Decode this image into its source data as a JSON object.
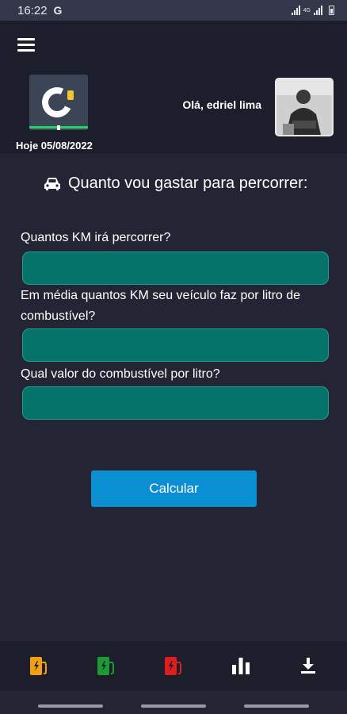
{
  "status_bar": {
    "time": "16:22",
    "g_label": "G",
    "lte": "4G"
  },
  "header": {
    "date_text": "Hoje 05/08/2022",
    "greeting": "Olá, edriel lima"
  },
  "form": {
    "title": "Quanto vou gastar para percorrer:",
    "km_label": "Quantos KM irá percorrer?",
    "km_value": "",
    "consumption_label": "Em média quantos KM seu veículo faz por litro de combustível?",
    "consumption_value": "",
    "price_label": "Qual valor do combustível por litro?",
    "price_value": "",
    "submit_label": "Calcular"
  },
  "bottom_nav": [
    {
      "icon": "fuel-pump-icon",
      "color": "#f0a010"
    },
    {
      "icon": "fuel-pump-icon",
      "color": "#1d9a33"
    },
    {
      "icon": "fuel-pump-icon",
      "color": "#e01d1d"
    },
    {
      "icon": "bar-chart-icon",
      "color": "#ffffff"
    },
    {
      "icon": "download-icon",
      "color": "#ffffff"
    }
  ],
  "colors": {
    "background": "#232535",
    "header": "#1c1e2b",
    "field": "#06736a",
    "button": "#0a8fd3"
  }
}
